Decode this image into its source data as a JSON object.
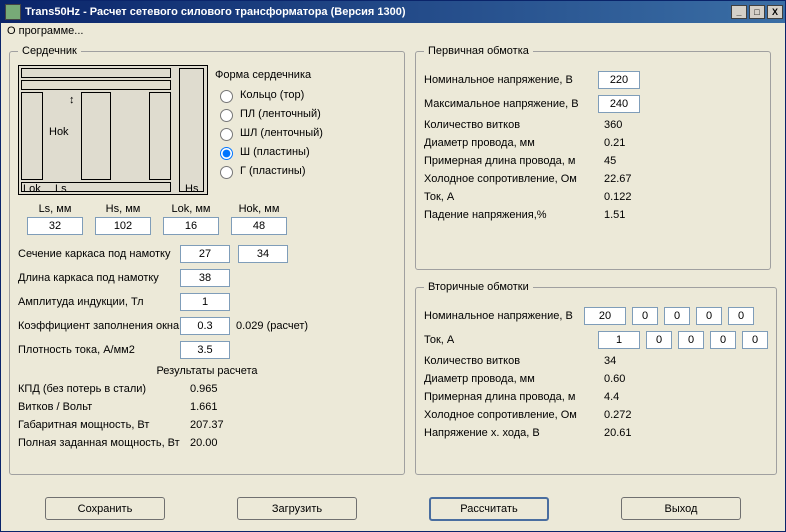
{
  "window": {
    "title": "Trans50Hz - Расчет сетевого силового трансформатора (Версия 1300)"
  },
  "menu": {
    "about": "О программе..."
  },
  "core": {
    "legend": "Сердечник",
    "shape_label": "Форма сердечника",
    "radios": {
      "ring": "Кольцо (тор)",
      "pl": "ПЛ (ленточный)",
      "shl": "ШЛ (ленточный)",
      "sh": "Ш (пластины)",
      "g": "Г (пластины)"
    },
    "diagram_labels": {
      "hok": "Hok",
      "lok": "Lok",
      "ls": "Ls",
      "hs": "Hs"
    },
    "dims": {
      "ls_h": "Ls, мм",
      "hs_h": "Hs, мм",
      "lok_h": "Lok, мм",
      "hok_h": "Hok, мм",
      "ls": "32",
      "hs": "102",
      "lok": "16",
      "hok": "48"
    },
    "params": {
      "section_label": "Сечение каркаса под намотку",
      "section1": "27",
      "section2": "34",
      "length_label": "Длина каркаса под намотку",
      "length": "38",
      "induction_label": "Амплитуда индукции, Тл",
      "induction": "1",
      "fill_label": "Коэффициент заполнения окна",
      "fill": "0.3",
      "fill_calc": "0.029 (расчет)",
      "density_label": "Плотность тока, А/мм2",
      "density": "3.5"
    },
    "results": {
      "header": "Результаты расчета",
      "kpd_label": "КПД (без потерь в стали)",
      "kpd": "0.965",
      "vv_label": "Витков / Вольт",
      "vv": "1.661",
      "gpow_label": "Габаритная мощность, Вт",
      "gpow": "207.37",
      "fpow_label": "Полная заданная мощность, Вт",
      "fpow": "20.00"
    }
  },
  "primary": {
    "legend": "Первичная обмотка",
    "nom_v_label": "Номинальное напряжение, В",
    "nom_v": "220",
    "max_v_label": "Максимальное напряжение, В",
    "max_v": "240",
    "turns_label": "Количество витков",
    "turns": "360",
    "wire_d_label": "Диаметр провода, мм",
    "wire_d": "0.21",
    "wire_len_label": "Примерная длина провода, м",
    "wire_len": "45",
    "cold_r_label": "Холодное сопротивление, Ом",
    "cold_r": "22.67",
    "cur_label": "Ток, А",
    "cur": "0.122",
    "vdrop_label": "Падение напряжения,%",
    "vdrop": "1.51"
  },
  "secondary": {
    "legend": "Вторичные обмотки",
    "nom_v_label": "Номинальное напряжение, В",
    "nom_v": [
      "20",
      "0",
      "0",
      "0",
      "0"
    ],
    "cur_label": "Ток, А",
    "cur": [
      "1",
      "0",
      "0",
      "0",
      "0"
    ],
    "turns_label": "Количество витков",
    "turns": "34",
    "wire_d_label": "Диаметр провода, мм",
    "wire_d": "0.60",
    "wire_len_label": "Примерная длина провода, м",
    "wire_len": "4.4",
    "cold_r_label": "Холодное сопротивление, Ом",
    "cold_r": "0.272",
    "idle_v_label": "Напряжение х. хода, В",
    "idle_v": "20.61"
  },
  "buttons": {
    "save": "Сохранить",
    "load": "Загрузить",
    "calc": "Рассчитать",
    "exit": "Выход"
  }
}
